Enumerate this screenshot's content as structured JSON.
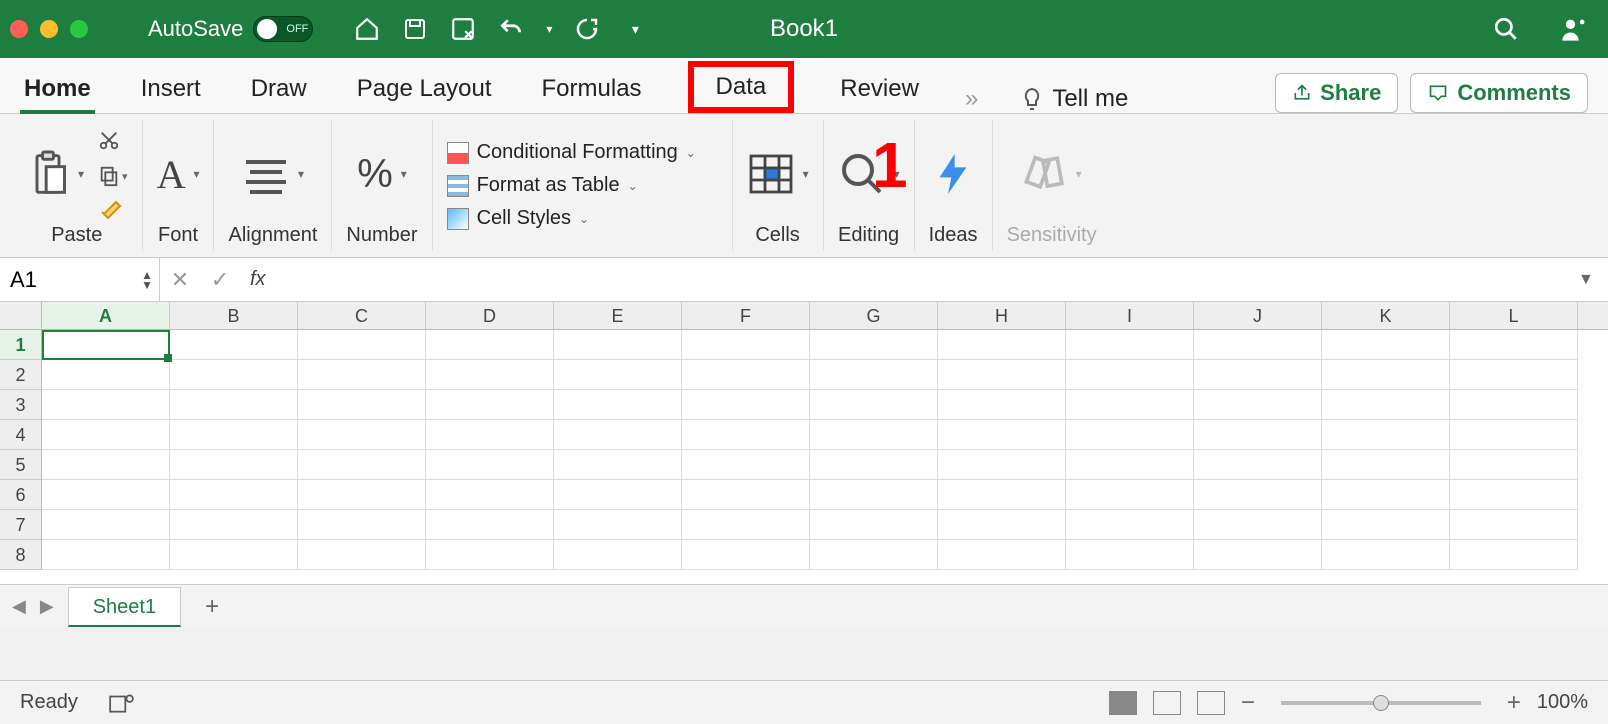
{
  "titlebar": {
    "autosave_label": "AutoSave",
    "autosave_state": "OFF",
    "document_title": "Book1"
  },
  "ribbon": {
    "tabs": [
      "Home",
      "Insert",
      "Draw",
      "Page Layout",
      "Formulas",
      "Data",
      "Review"
    ],
    "active_tab": "Home",
    "highlighted_tab": "Data",
    "tell_me": "Tell me",
    "share": "Share",
    "comments": "Comments"
  },
  "annotation": {
    "callout_1": "1"
  },
  "ribbon_groups": {
    "paste": "Paste",
    "font": "Font",
    "alignment": "Alignment",
    "number": "Number",
    "cond_format": "Conditional Formatting",
    "format_table": "Format as Table",
    "cell_styles": "Cell Styles",
    "cells": "Cells",
    "editing": "Editing",
    "ideas": "Ideas",
    "sensitivity": "Sensitivity"
  },
  "formula_bar": {
    "name_box": "A1",
    "fx_label": "fx",
    "formula": ""
  },
  "grid": {
    "columns": [
      "A",
      "B",
      "C",
      "D",
      "E",
      "F",
      "G",
      "H",
      "I",
      "J",
      "K",
      "L"
    ],
    "rows": [
      1,
      2,
      3,
      4,
      5,
      6,
      7,
      8
    ],
    "selected_cell": "A1"
  },
  "sheets": {
    "active": "Sheet1"
  },
  "status": {
    "mode": "Ready",
    "zoom": "100%"
  }
}
